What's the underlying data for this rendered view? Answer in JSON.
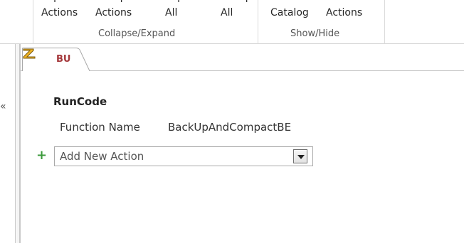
{
  "ribbon": {
    "cut_labels": [
      "Expand",
      "Collapse",
      "Expand",
      "Collapse",
      "Action",
      "All"
    ],
    "buttons": {
      "expand_actions": "Actions",
      "collapse_actions": "Actions",
      "expand_all": "All",
      "collapse_all": "All",
      "action_catalog": "Catalog",
      "show_all_actions": "Actions"
    },
    "groups": {
      "collapse_expand": "Collapse/Expand",
      "show_hide": "Show/Hide"
    }
  },
  "nav": {
    "toggle_glyph": "«"
  },
  "tab": {
    "label": "BU"
  },
  "macro": {
    "action_name": "RunCode",
    "argument_label": "Function Name",
    "argument_value": "BackUpAndCompactBE",
    "add_new_action_placeholder": "Add New Action"
  },
  "colors": {
    "tab_label": "#a4373a",
    "add_plus": "#3b9a3b"
  }
}
